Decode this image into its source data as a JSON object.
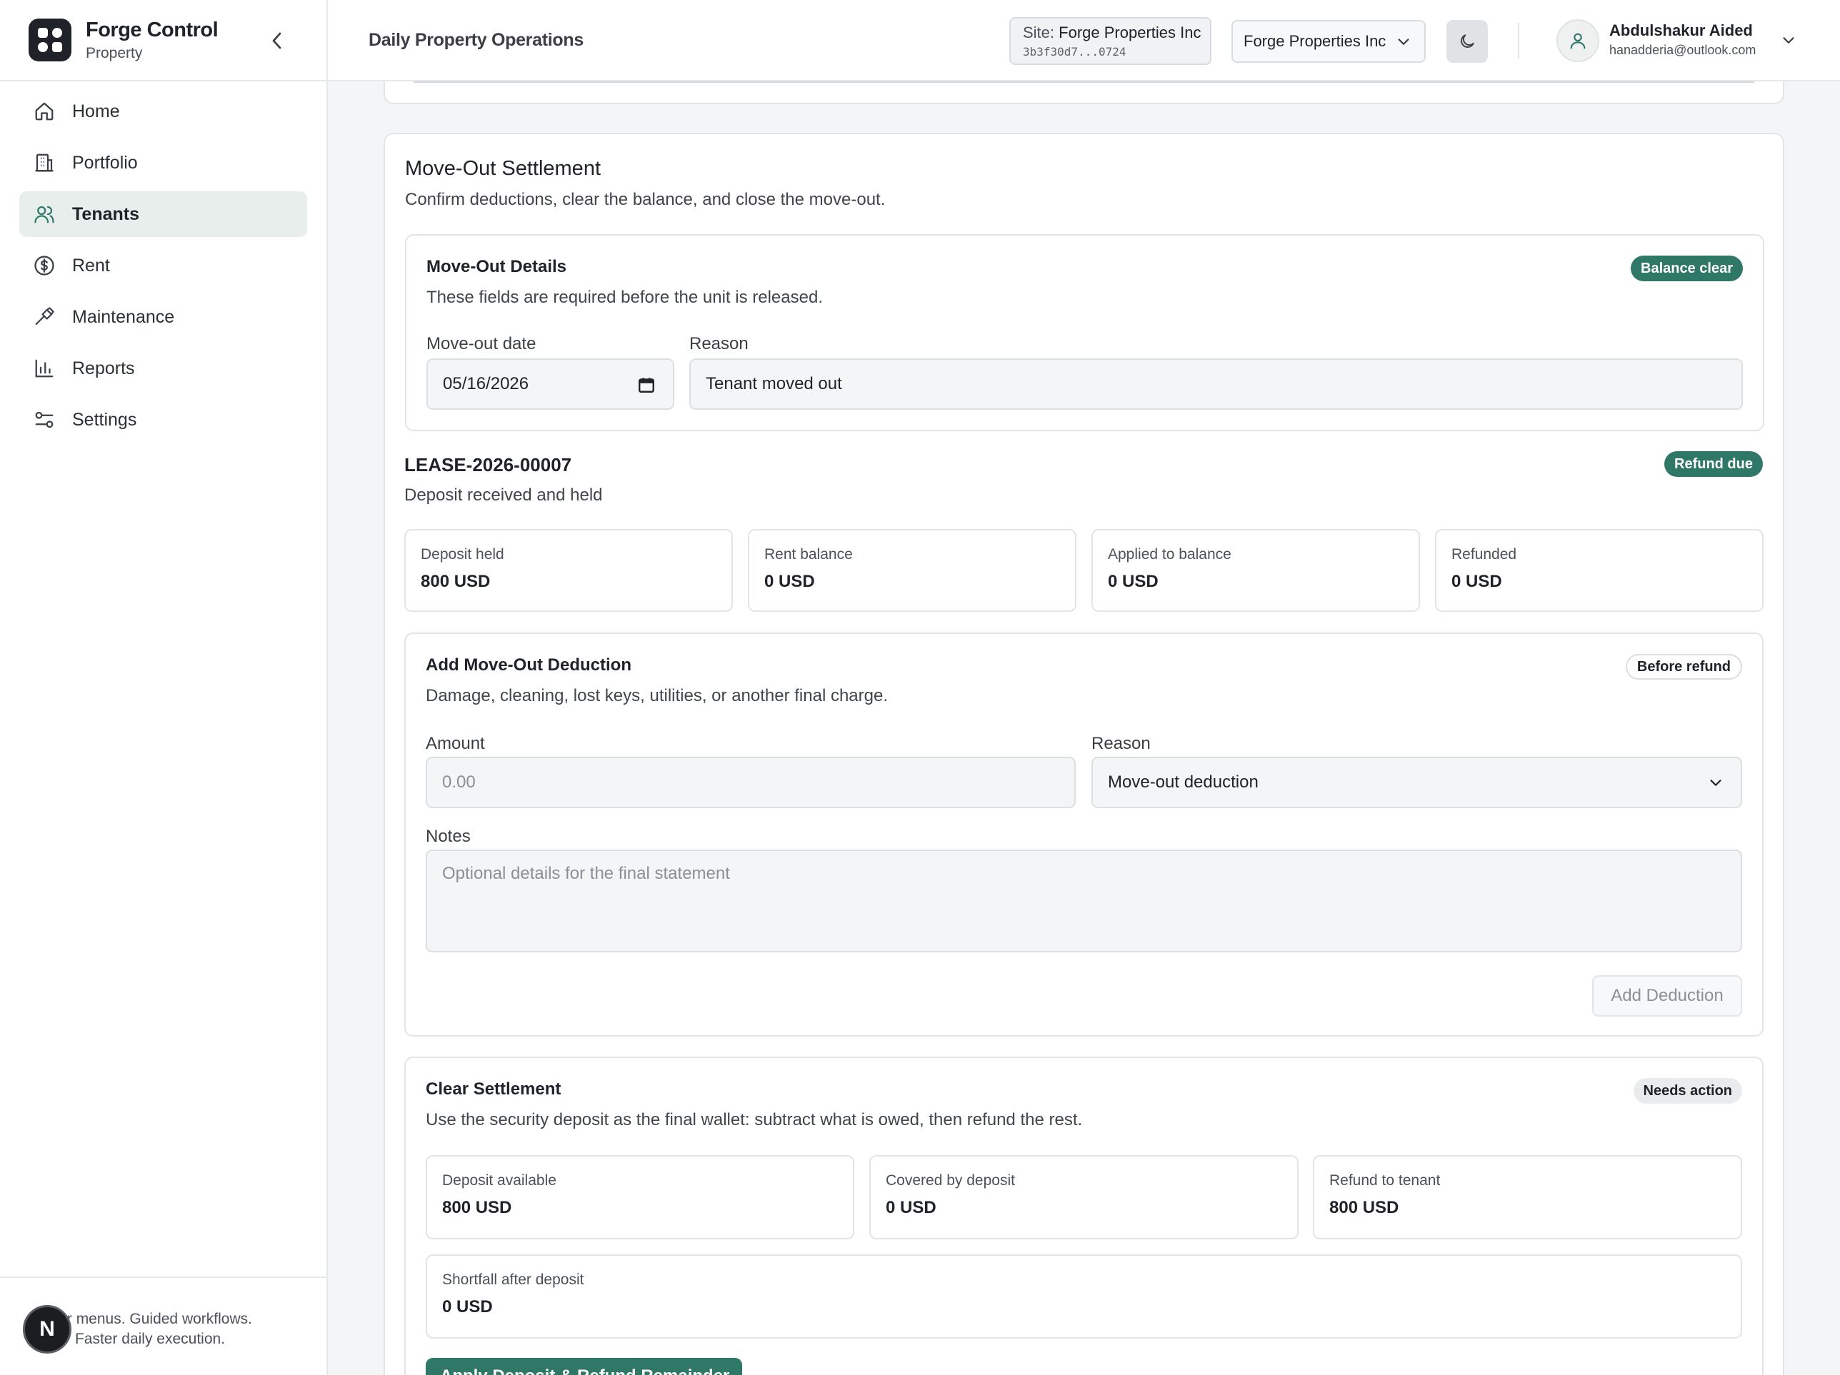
{
  "brand": {
    "title": "Forge Control",
    "subtitle": "Property"
  },
  "nav": [
    {
      "label": "Home",
      "icon": "home-icon",
      "active": false
    },
    {
      "label": "Portfolio",
      "icon": "building-icon",
      "active": false
    },
    {
      "label": "Tenants",
      "icon": "users-icon",
      "active": true
    },
    {
      "label": "Rent",
      "icon": "dollar-icon",
      "active": false
    },
    {
      "label": "Maintenance",
      "icon": "hammer-icon",
      "active": false
    },
    {
      "label": "Reports",
      "icon": "bar-chart-icon",
      "active": false
    },
    {
      "label": "Settings",
      "icon": "sliders-icon",
      "active": false
    }
  ],
  "sidebar_footer": {
    "line1": "wer menus. Guided workflows.",
    "line2": "Faster daily execution.",
    "badge_letter": "N"
  },
  "header": {
    "page_title": "Daily Property Operations",
    "site_label": "Site:",
    "site_name": "Forge Properties Inc",
    "site_id": "3b3f30d7...0724",
    "company_select": "Forge Properties Inc",
    "user_name": "Abdulshakur Aided",
    "user_email": "hanadderia@outlook.com"
  },
  "settlement": {
    "title": "Move-Out Settlement",
    "subtitle": "Confirm deductions, clear the balance, and close the move-out.",
    "details": {
      "title": "Move-Out Details",
      "subtitle": "These fields are required before the unit is released.",
      "badge": "Balance clear",
      "date_label": "Move-out date",
      "date_value": "05/16/2026",
      "reason_label": "Reason",
      "reason_value": "Tenant moved out"
    },
    "lease": {
      "id": "LEASE-2026-00007",
      "subtitle": "Deposit received and held",
      "badge": "Refund due",
      "stats": [
        {
          "label": "Deposit held",
          "value": "800 USD"
        },
        {
          "label": "Rent balance",
          "value": "0 USD"
        },
        {
          "label": "Applied to balance",
          "value": "0 USD"
        },
        {
          "label": "Refunded",
          "value": "0 USD"
        }
      ]
    },
    "deduction": {
      "title": "Add Move-Out Deduction",
      "subtitle": "Damage, cleaning, lost keys, utilities, or another final charge.",
      "badge": "Before refund",
      "amount_label": "Amount",
      "amount_placeholder": "0.00",
      "reason_label": "Reason",
      "reason_value": "Move-out deduction",
      "notes_label": "Notes",
      "notes_placeholder": "Optional details for the final statement",
      "button": "Add Deduction"
    },
    "clear": {
      "title": "Clear Settlement",
      "subtitle": "Use the security deposit as the final wallet: subtract what is owed, then refund the rest.",
      "badge": "Needs action",
      "stats": [
        {
          "label": "Deposit available",
          "value": "800 USD"
        },
        {
          "label": "Covered by deposit",
          "value": "0 USD"
        },
        {
          "label": "Refund to tenant",
          "value": "800 USD"
        }
      ],
      "shortfall": {
        "label": "Shortfall after deposit",
        "value": "0 USD"
      },
      "button": "Apply Deposit & Refund Remainder"
    }
  },
  "colors": {
    "accent": "#2f7766",
    "active_nav_bg": "#e8eeec",
    "page_bg": "#f4f5f6"
  }
}
